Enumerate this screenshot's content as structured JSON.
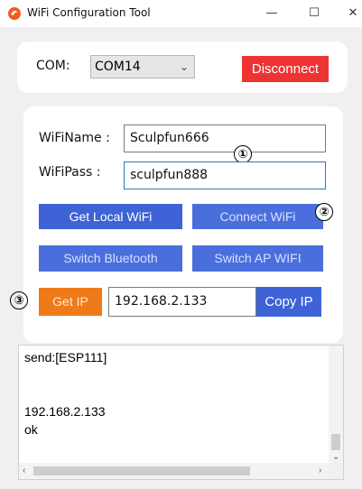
{
  "window": {
    "title": "WiFi Configuration Tool",
    "minimize": "—",
    "maximize": "☐",
    "close": "✕"
  },
  "com": {
    "label": "COM:",
    "value": "COM14",
    "disconnect": "Disconnect"
  },
  "wifi": {
    "name_label": "WiFiName :",
    "name_value": "Sculpfun666",
    "pass_label": "WiFiPass :",
    "pass_value": "sculpfun888"
  },
  "buttons": {
    "get_local_wifi": "Get Local WiFi",
    "connect_wifi": "Connect WiFi",
    "switch_bluetooth": "Switch Bluetooth",
    "switch_ap_wifi": "Switch AP WIFI",
    "get_ip": "Get IP",
    "copy_ip": "Copy IP"
  },
  "ip": {
    "value": "192.168.2.133"
  },
  "markers": {
    "one": "①",
    "two": "②",
    "three": "③"
  },
  "log": {
    "lines": [
      "send:[ESP111]",
      "192.168.2.133",
      "ok"
    ]
  },
  "colors": {
    "disconnect": "#ee3333",
    "action_blue": "#3e63d6",
    "get_ip_orange": "#ef7a1a"
  }
}
